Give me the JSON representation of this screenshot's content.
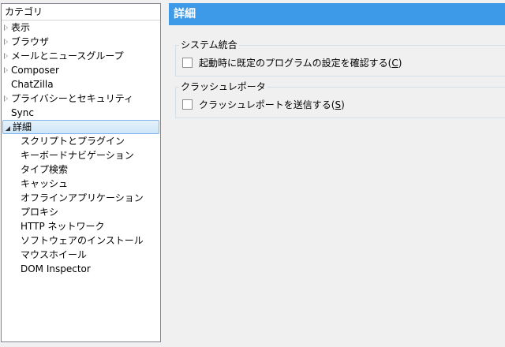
{
  "sidebar": {
    "title": "カテゴリ",
    "items": [
      {
        "label": "表示",
        "twisty": "closed"
      },
      {
        "label": "ブラウザ",
        "twisty": "closed"
      },
      {
        "label": "メールとニュースグループ",
        "twisty": "closed"
      },
      {
        "label": "Composer",
        "twisty": "closed"
      },
      {
        "label": "ChatZilla",
        "twisty": "none"
      },
      {
        "label": "プライバシーとセキュリティ",
        "twisty": "closed"
      },
      {
        "label": "Sync",
        "twisty": "none"
      },
      {
        "label": "詳細",
        "twisty": "open",
        "selected": true
      }
    ],
    "children": [
      "スクリプトとプラグイン",
      "キーボードナビゲーション",
      "タイプ検索",
      "キャッシュ",
      "オフラインアプリケーション",
      "プロキシ",
      "HTTP ネットワーク",
      "ソフトウェアのインストール",
      "マウスホイール",
      "DOM Inspector"
    ]
  },
  "header": {
    "title": "詳細"
  },
  "groups": {
    "system": {
      "caption": "システム統合",
      "option_text": "起動時に既定のプログラムの設定を確認する(",
      "option_key": "C",
      "option_close": ")"
    },
    "crash": {
      "caption": "クラッシュレポータ",
      "option_text": "クラッシュレポートを送信する(",
      "option_key": "S",
      "option_close": ")"
    }
  },
  "colors": {
    "header_bg": "#3c9ae8",
    "selected_border": "#7eb4ea"
  }
}
